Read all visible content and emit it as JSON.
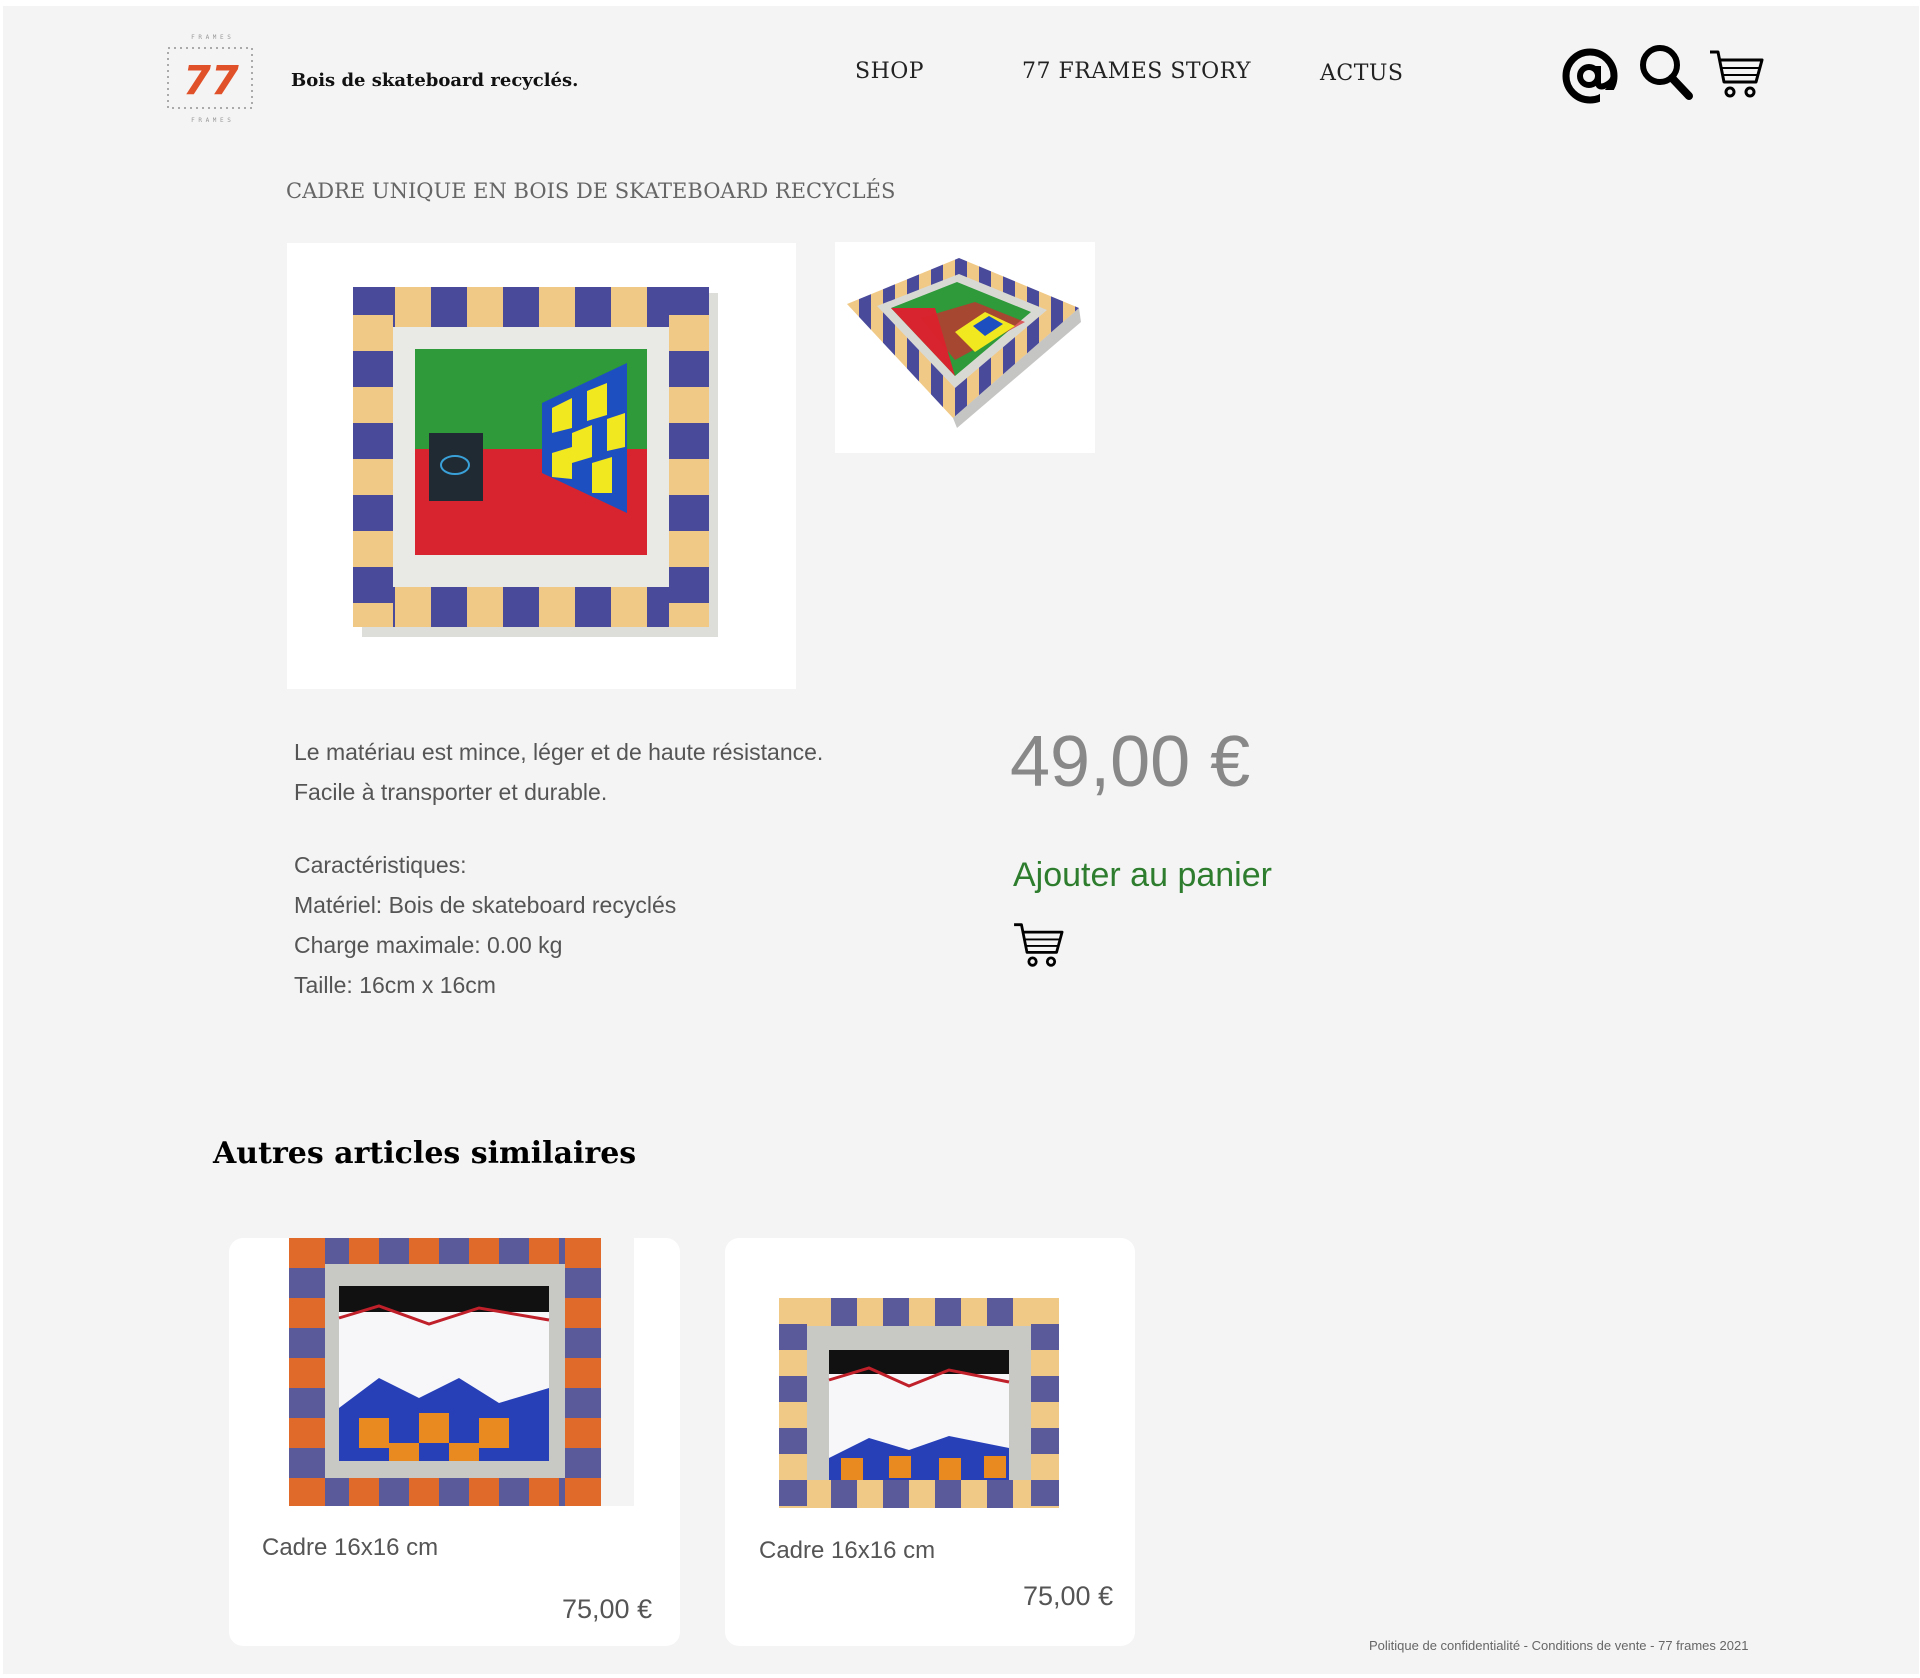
{
  "header": {
    "logo_text": "77",
    "logo_top_text": "F R A M E S",
    "logo_bottom_text": "F R A M E S",
    "tagline": "Bois de skateboard recyclés.",
    "nav": [
      {
        "label": "SHOP"
      },
      {
        "label": "77 FRAMES STORY"
      },
      {
        "label": "ACTUS"
      }
    ],
    "icons": [
      "at-sign-icon",
      "search-icon",
      "cart-icon"
    ]
  },
  "product": {
    "title": "CADRE UNIQUE EN BOIS DE SKATEBOARD RECYCLÉS",
    "description": [
      "Le matériau est mince, léger et de haute résistance.",
      "Facile à transporter et durable."
    ],
    "characteristics": [
      "Caractéristiques:",
      "Matériel: Bois de skateboard recyclés",
      "Charge maximale: 0.00 kg",
      "Taille: 16cm x 16cm"
    ],
    "price": "49,00 €",
    "add_to_cart": "Ajouter au panier"
  },
  "similar": {
    "title": "Autres articles similaires",
    "items": [
      {
        "name": "Cadre 16x16 cm",
        "price": "75,00 €"
      },
      {
        "name": "Cadre 16x16 cm",
        "price": "75,00 €"
      }
    ]
  },
  "footer": {
    "privacy": "Politique de confidentialité",
    "separator": " - ",
    "terms": "Conditions de vente",
    "copyright": "77 frames 2021"
  },
  "colors": {
    "background": "#f4f4f4",
    "accent_green": "#2e7d2e",
    "logo_orange": "#e0512a",
    "frame_blue": "#4a4a9a",
    "frame_wood": "#f0c987"
  }
}
